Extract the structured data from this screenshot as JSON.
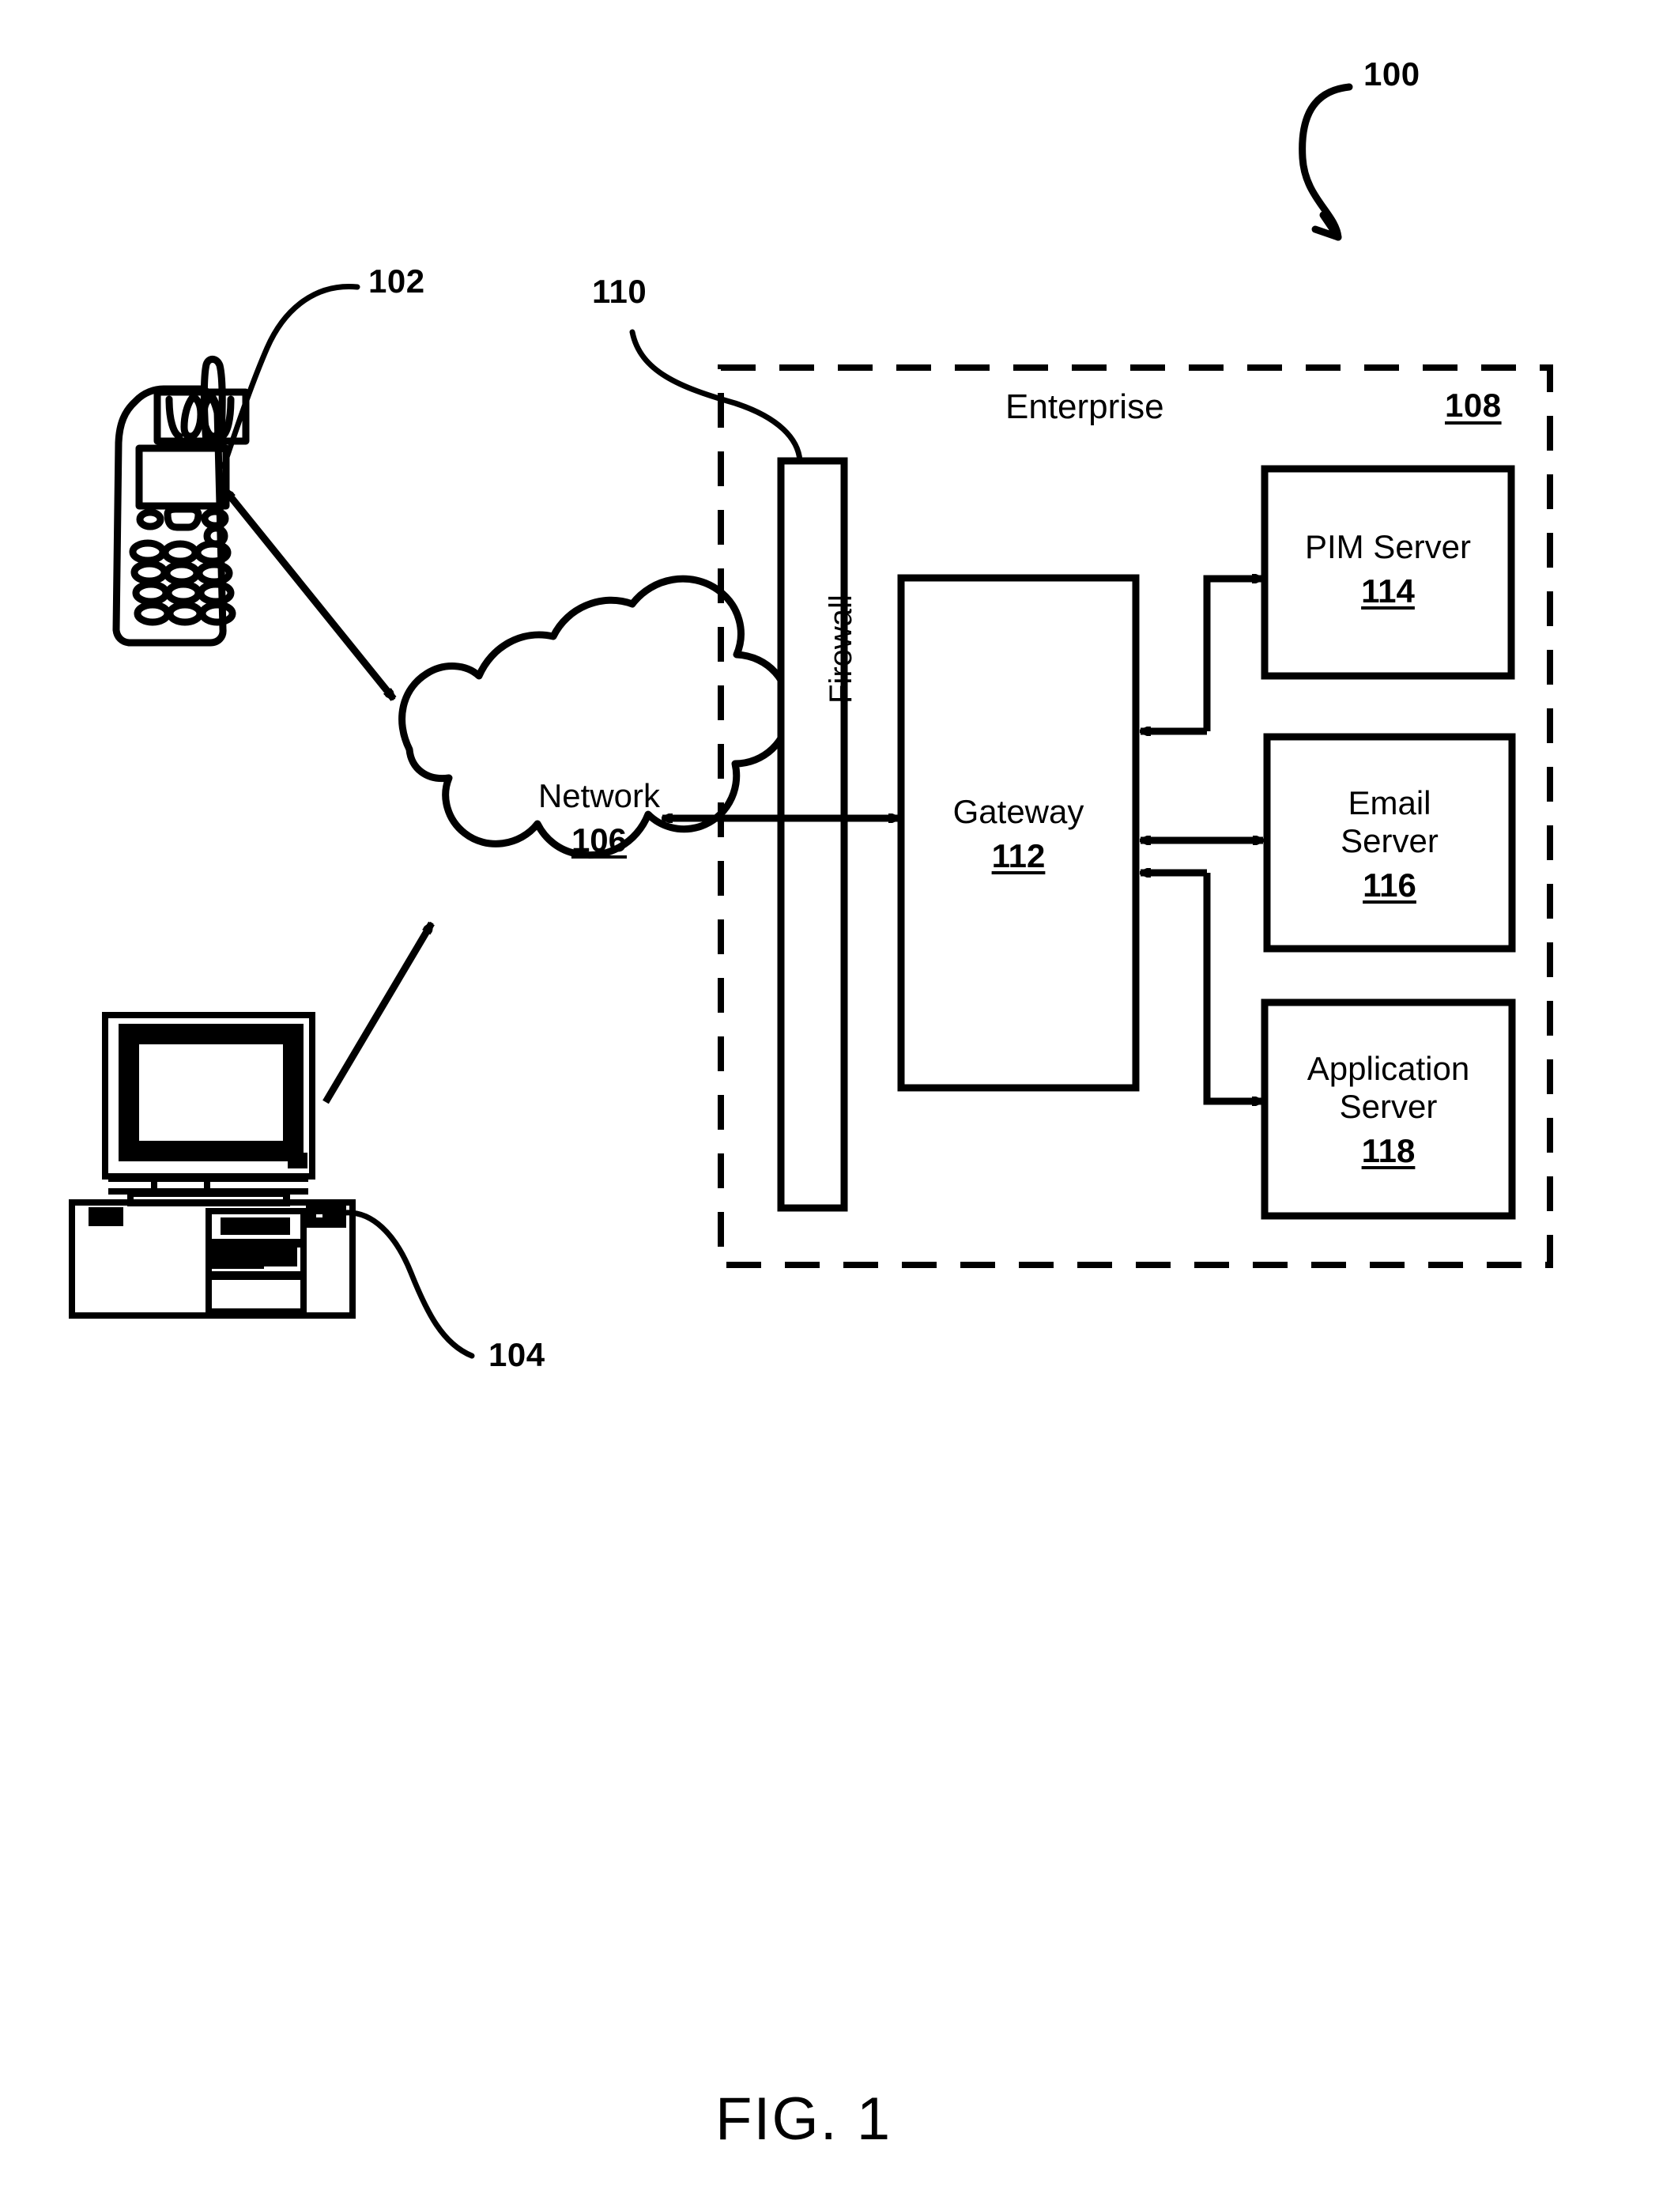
{
  "figure": {
    "caption": "FIG. 1",
    "system_ref": "100"
  },
  "refs": {
    "mobile_device": "102",
    "computer": "104",
    "firewall": "110",
    "enterprise": "108"
  },
  "nodes": {
    "network": {
      "label": "Network",
      "ref": "106"
    },
    "firewall": {
      "label": "Firewall"
    },
    "enterprise": {
      "label": "Enterprise",
      "ref": "108"
    },
    "gateway": {
      "label": "Gateway",
      "ref": "112"
    },
    "pim_server": {
      "label": "PIM Server",
      "ref": "114"
    },
    "email_server": {
      "label_line1": "Email",
      "label_line2": "Server",
      "ref": "116"
    },
    "application_server": {
      "label_line1": "Application",
      "label_line2": "Server",
      "ref": "118"
    }
  },
  "icons": {
    "mobile_phone": "mobile-phone-icon",
    "desktop_computer": "desktop-computer-icon",
    "network_cloud": "network-cloud-icon"
  },
  "colors": {
    "ink": "#000000",
    "paper": "#ffffff"
  }
}
